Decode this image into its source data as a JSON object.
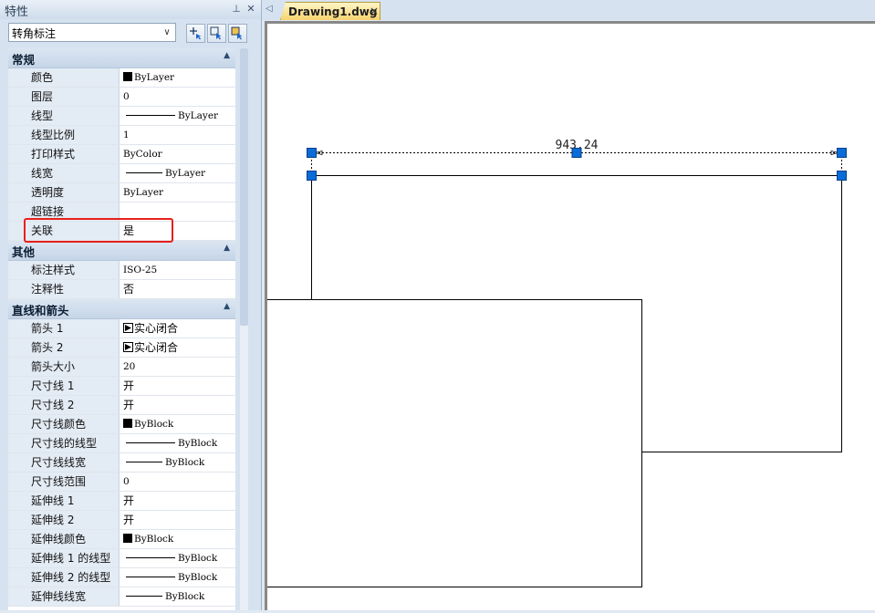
{
  "panel": {
    "title": "特性",
    "pin_icon": "pin-icon",
    "close_icon": "close-icon",
    "selector_value": "转角标注",
    "quick_buttons": [
      "quick-select-icon",
      "select-objects-icon",
      "pickadd-toggle-icon"
    ]
  },
  "sections": [
    {
      "title": "常规",
      "rows": [
        {
          "label": "颜色",
          "value": "ByLayer",
          "swatch": "#000000"
        },
        {
          "label": "图层",
          "value": "0"
        },
        {
          "label": "线型",
          "value": "ByLayer",
          "line": "long"
        },
        {
          "label": "线型比例",
          "value": "1"
        },
        {
          "label": "打印样式",
          "value": "ByColor"
        },
        {
          "label": "线宽",
          "value": "ByLayer",
          "line": "short"
        },
        {
          "label": "透明度",
          "value": "ByLayer"
        },
        {
          "label": "超链接",
          "value": ""
        },
        {
          "label": "关联",
          "value": "是",
          "cjk": true
        }
      ]
    },
    {
      "title": "其他",
      "rows": [
        {
          "label": "标注样式",
          "value": "ISO-25"
        },
        {
          "label": "注释性",
          "value": "否",
          "cjk": true
        }
      ]
    },
    {
      "title": "直线和箭头",
      "rows": [
        {
          "label": "箭头 1",
          "value": "实心闭合",
          "arrow": true,
          "cjk": true
        },
        {
          "label": "箭头 2",
          "value": "实心闭合",
          "arrow": true,
          "cjk": true
        },
        {
          "label": "箭头大小",
          "value": "20"
        },
        {
          "label": "尺寸线 1",
          "value": "开",
          "cjk": true
        },
        {
          "label": "尺寸线 2",
          "value": "开",
          "cjk": true
        },
        {
          "label": "尺寸线颜色",
          "value": "ByBlock",
          "swatch": "#000000"
        },
        {
          "label": "尺寸线的线型",
          "value": "ByBlock",
          "line": "long"
        },
        {
          "label": "尺寸线线宽",
          "value": "ByBlock",
          "line": "short"
        },
        {
          "label": "尺寸线范围",
          "value": "0"
        },
        {
          "label": "延伸线 1",
          "value": "开",
          "cjk": true
        },
        {
          "label": "延伸线 2",
          "value": "开",
          "cjk": true
        },
        {
          "label": "延伸线颜色",
          "value": "ByBlock",
          "swatch": "#000000"
        },
        {
          "label": "延伸线 1 的线型",
          "value": "ByBlock",
          "line": "long"
        },
        {
          "label": "延伸线 2 的线型",
          "value": "ByBlock",
          "line": "long"
        },
        {
          "label": "延伸线线宽",
          "value": "ByBlock",
          "line": "short"
        }
      ]
    }
  ],
  "document": {
    "tab_label": "Drawing1.dwg",
    "tab_close": "×",
    "scroll_left_icon": "tab-scroll-left-icon",
    "dimension_text": "943.24",
    "accent": "#0a6cd8"
  }
}
